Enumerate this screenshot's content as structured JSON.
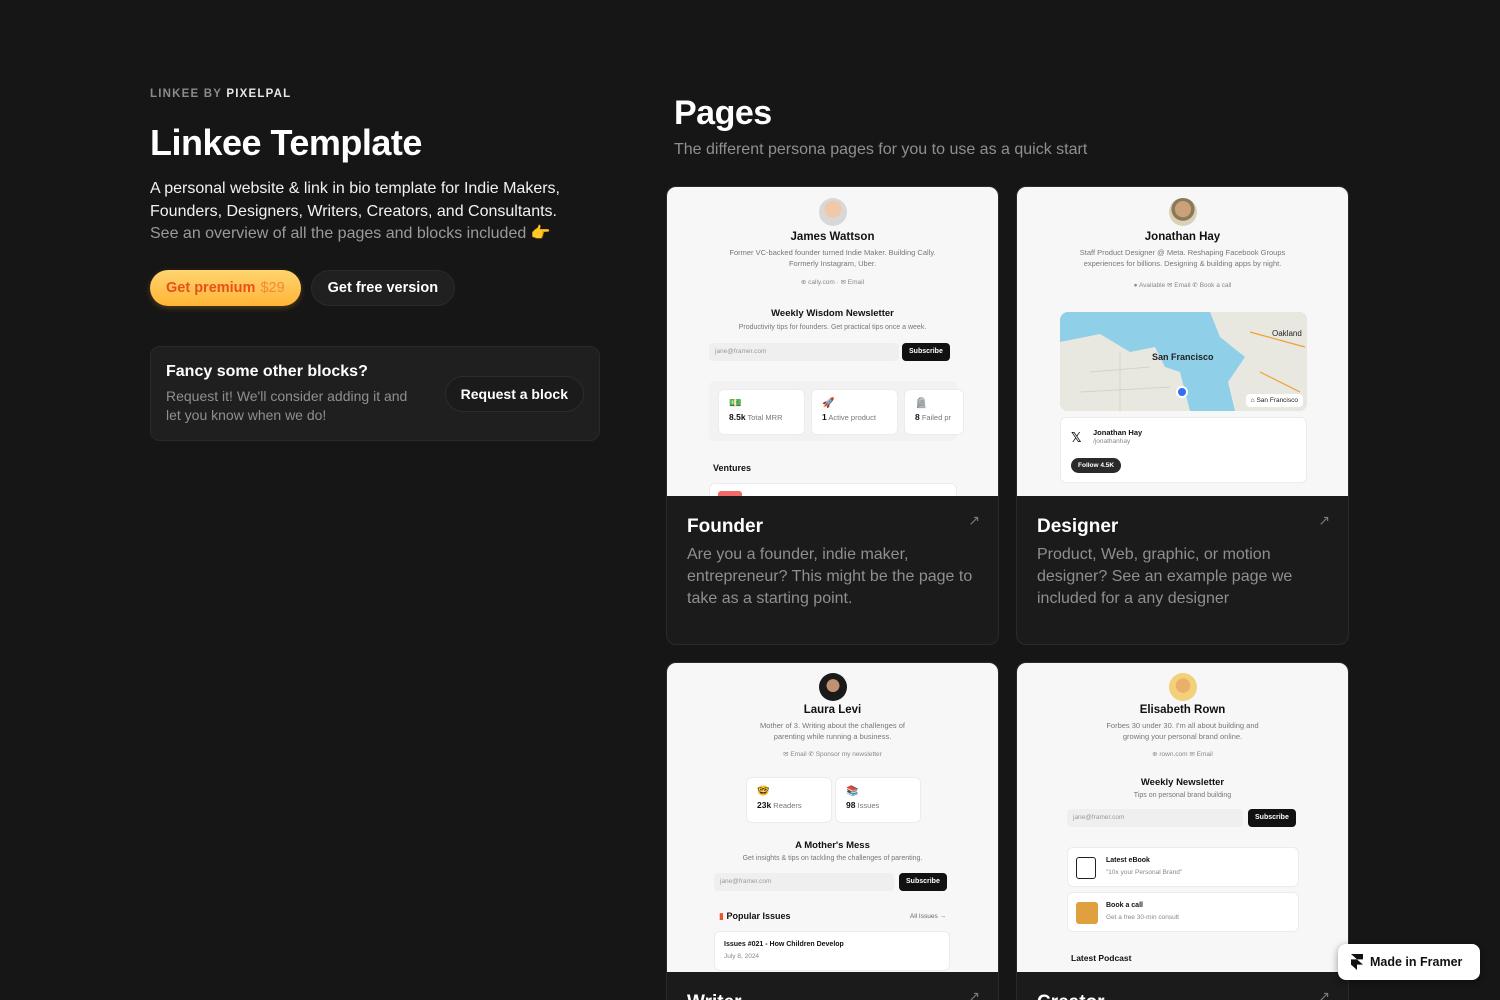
{
  "brand": {
    "prefix": "LINKEE BY",
    "name": "PIXELPAL"
  },
  "hero": {
    "title": "Linkee Template",
    "lede": "A personal website & link in bio template for Indie Makers, Founders, Designers, Writers, Creators, and Consultants.",
    "lede_muted": "See an overview of all the pages and blocks included 👉",
    "premium_label": "Get premium",
    "premium_price": "$29",
    "free_label": "Get free version"
  },
  "fancy": {
    "title": "Fancy some other blocks?",
    "text": "Request it! We'll consider adding it and let you know when we do!",
    "button": "Request a block"
  },
  "pages": {
    "title": "Pages",
    "subtitle": "The different persona pages for you to use as a quick start",
    "cards": [
      {
        "name": "Founder",
        "desc": "Are you a founder, indie maker, entrepreneur? This might be the page to take as a starting point.",
        "preview": {
          "person": "James Wattson",
          "bio": "Former VC-backed founder turned Indie Maker. Building Cally. Formerly Instagram, Uber.",
          "links": "⊕ cally.com  ·  ✉ Email",
          "newsletter_title": "Weekly Wisdom Newsletter",
          "newsletter_sub": "Productivity tips for founders. Get practical tips once a week.",
          "input": "jane@framer.com",
          "subscribe": "Subscribe",
          "stats": [
            {
              "emoji": "💵",
              "value": "8.5k",
              "label": "Total MRR"
            },
            {
              "emoji": "🚀",
              "value": "1",
              "label": "Active product"
            },
            {
              "emoji": "🪦",
              "value": "8",
              "label": "Failed pr"
            }
          ],
          "section": "Ventures"
        }
      },
      {
        "name": "Designer",
        "desc": "Product, Web, graphic, or motion designer? See an example page we included for a any designer",
        "preview": {
          "person": "Jonathan Hay",
          "bio": "Staff Product Designer @ Meta. Reshaping Facebook Groups experiences for billions. Designing & building apps by night.",
          "links": "● Available   ✉ Email   ✆ Book a call",
          "map_city": "San Francisco",
          "map_city2": "Oakland",
          "map_badge": "⌂ San Francisco",
          "x_name": "Jonathan Hay",
          "x_handle": "/jonathanhay",
          "x_follow": "Follow 4.5K"
        }
      },
      {
        "name": "Writer",
        "desc": "",
        "preview": {
          "person": "Laura Levi",
          "bio": "Mother of 3. Writing about the challenges of parenting while running a business.",
          "links": "✉ Email   ✆ Sponsor my newsletter",
          "stats": [
            {
              "emoji": "🤓",
              "value": "23k",
              "label": "Readers"
            },
            {
              "emoji": "📚",
              "value": "98",
              "label": "Issues"
            }
          ],
          "newsletter_title": "A Mother's Mess",
          "newsletter_sub": "Get insights & tips on tackling the challenges of parenting.",
          "input": "jane@framer.com",
          "subscribe": "Subscribe",
          "popular": "Popular Issues",
          "all_issues": "All Issues →",
          "issue_title": "Issues #021 - How Children Develop",
          "issue_date": "July 8, 2024"
        }
      },
      {
        "name": "Creator",
        "desc": "",
        "preview": {
          "person": "Elisabeth Rown",
          "bio": "Forbes 30 under 30. I'm all about building and growing your personal brand online.",
          "links": "⊕ rown.com   ✉ Email",
          "newsletter_title": "Weekly Newsletter",
          "newsletter_sub": "Tips on personal brand building",
          "input": "jane@framer.com",
          "subscribe": "Subscribe",
          "link1_title": "Latest eBook",
          "link1_sub": "\"10x your Personal Brand\"",
          "link2_title": "Book a call",
          "link2_sub": "Get a free 30-min consult",
          "section": "Latest Podcast"
        }
      }
    ]
  },
  "framer_badge": "Made in Framer"
}
